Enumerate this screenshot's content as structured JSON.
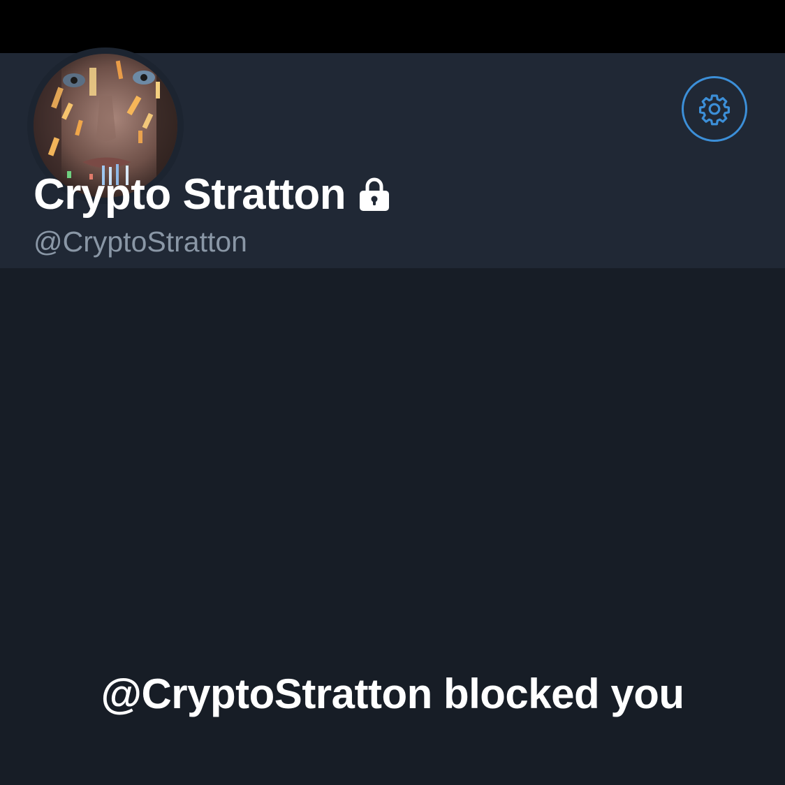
{
  "profile": {
    "display_name": "Crypto Stratton",
    "handle": "@CryptoStratton",
    "protected": true,
    "avatar": "profile-avatar-photo"
  },
  "actions": {
    "settings_icon": "gear-icon"
  },
  "message": {
    "blocked_text": "@CryptoStratton blocked you"
  },
  "colors": {
    "banner": "#000000",
    "header_bg": "#202835",
    "page_bg": "#171d26",
    "accent": "#3c8fd8",
    "handle_text": "#8a97a6",
    "primary_text": "#ffffff"
  }
}
